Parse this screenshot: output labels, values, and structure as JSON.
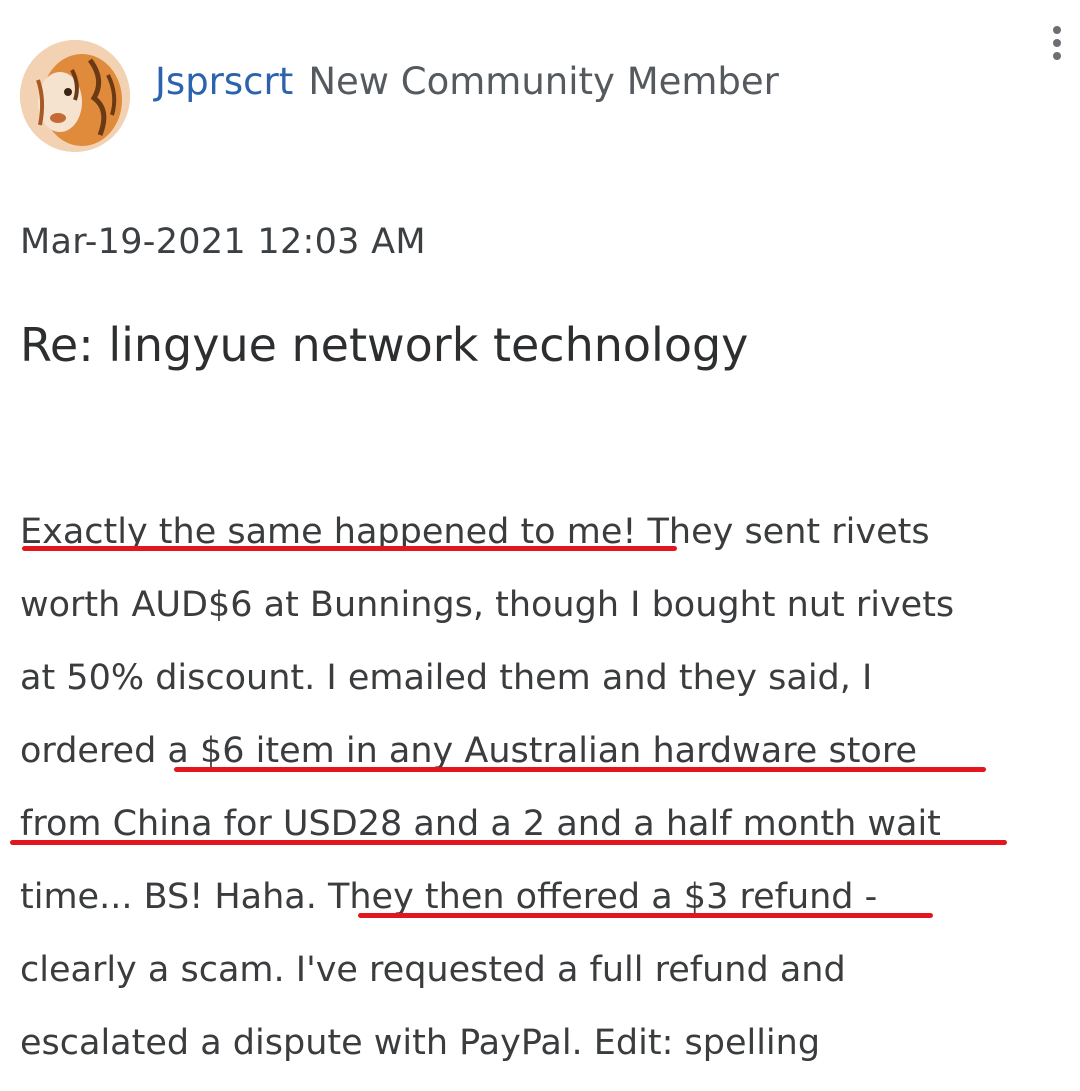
{
  "post": {
    "author": {
      "username": "Jsprscrt",
      "rank": "New Community Member",
      "avatar_icon": "tiger-avatar-icon"
    },
    "menu_icon": "more-options-vertical-icon",
    "timestamp": "Mar-19-2021 12:03 AM",
    "subject": "Re: lingyue network technology",
    "body_lines": [
      "Exactly the same happened to me! They sent rivets",
      "worth AUD$6 at Bunnings, though I bought nut rivets",
      "at 50% discount. I emailed them and they said, I",
      "ordered a $6 item in any Australian hardware store",
      "from China for USD28 and a 2 and a half month wait",
      "time... BS! Haha. They then offered a $3 refund -",
      "clearly a scam. I've requested a full refund and",
      "escalated a dispute with PayPal. Edit: spelling"
    ],
    "annotation_color": "#e3161d",
    "link_color": "#2b64ad"
  }
}
